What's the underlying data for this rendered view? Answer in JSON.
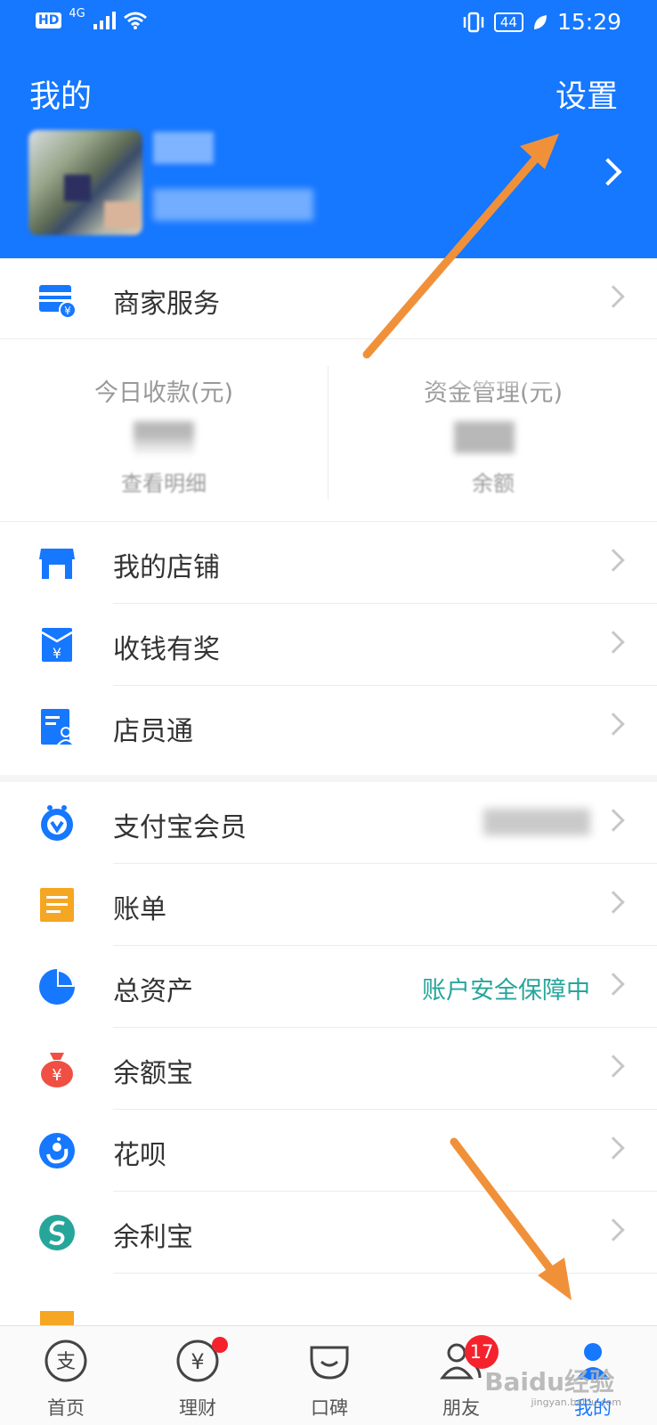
{
  "status_bar": {
    "hd": "HD",
    "net": "4G",
    "battery": "44",
    "time": "15:29"
  },
  "header": {
    "title": "我的",
    "settings_label": "设置"
  },
  "merchant_services": {
    "label": "商家服务"
  },
  "stats": {
    "left": {
      "title": "今日收款(元)",
      "sub": "查看明细"
    },
    "right": {
      "title": "资金管理(元)",
      "sub": "余额"
    }
  },
  "shop_items": [
    {
      "label": "我的店铺"
    },
    {
      "label": "收钱有奖"
    },
    {
      "label": "店员通"
    }
  ],
  "account_items": [
    {
      "label": "支付宝会员"
    },
    {
      "label": "账单"
    },
    {
      "label": "总资产",
      "extra": "账户安全保障中"
    },
    {
      "label": "余额宝"
    },
    {
      "label": "花呗"
    },
    {
      "label": "余利宝"
    }
  ],
  "tabs": [
    {
      "label": "首页"
    },
    {
      "label": "理财"
    },
    {
      "label": "口碑"
    },
    {
      "label": "朋友",
      "badge": "17"
    },
    {
      "label": "我的"
    }
  ],
  "watermark": {
    "text": "Baidu经验",
    "sub": "jingyan.baidu.com"
  },
  "colors": {
    "brand": "#1677ff",
    "teal": "#26a69a",
    "badge": "#f5222d",
    "annotation_arrow": "#f0913a"
  }
}
